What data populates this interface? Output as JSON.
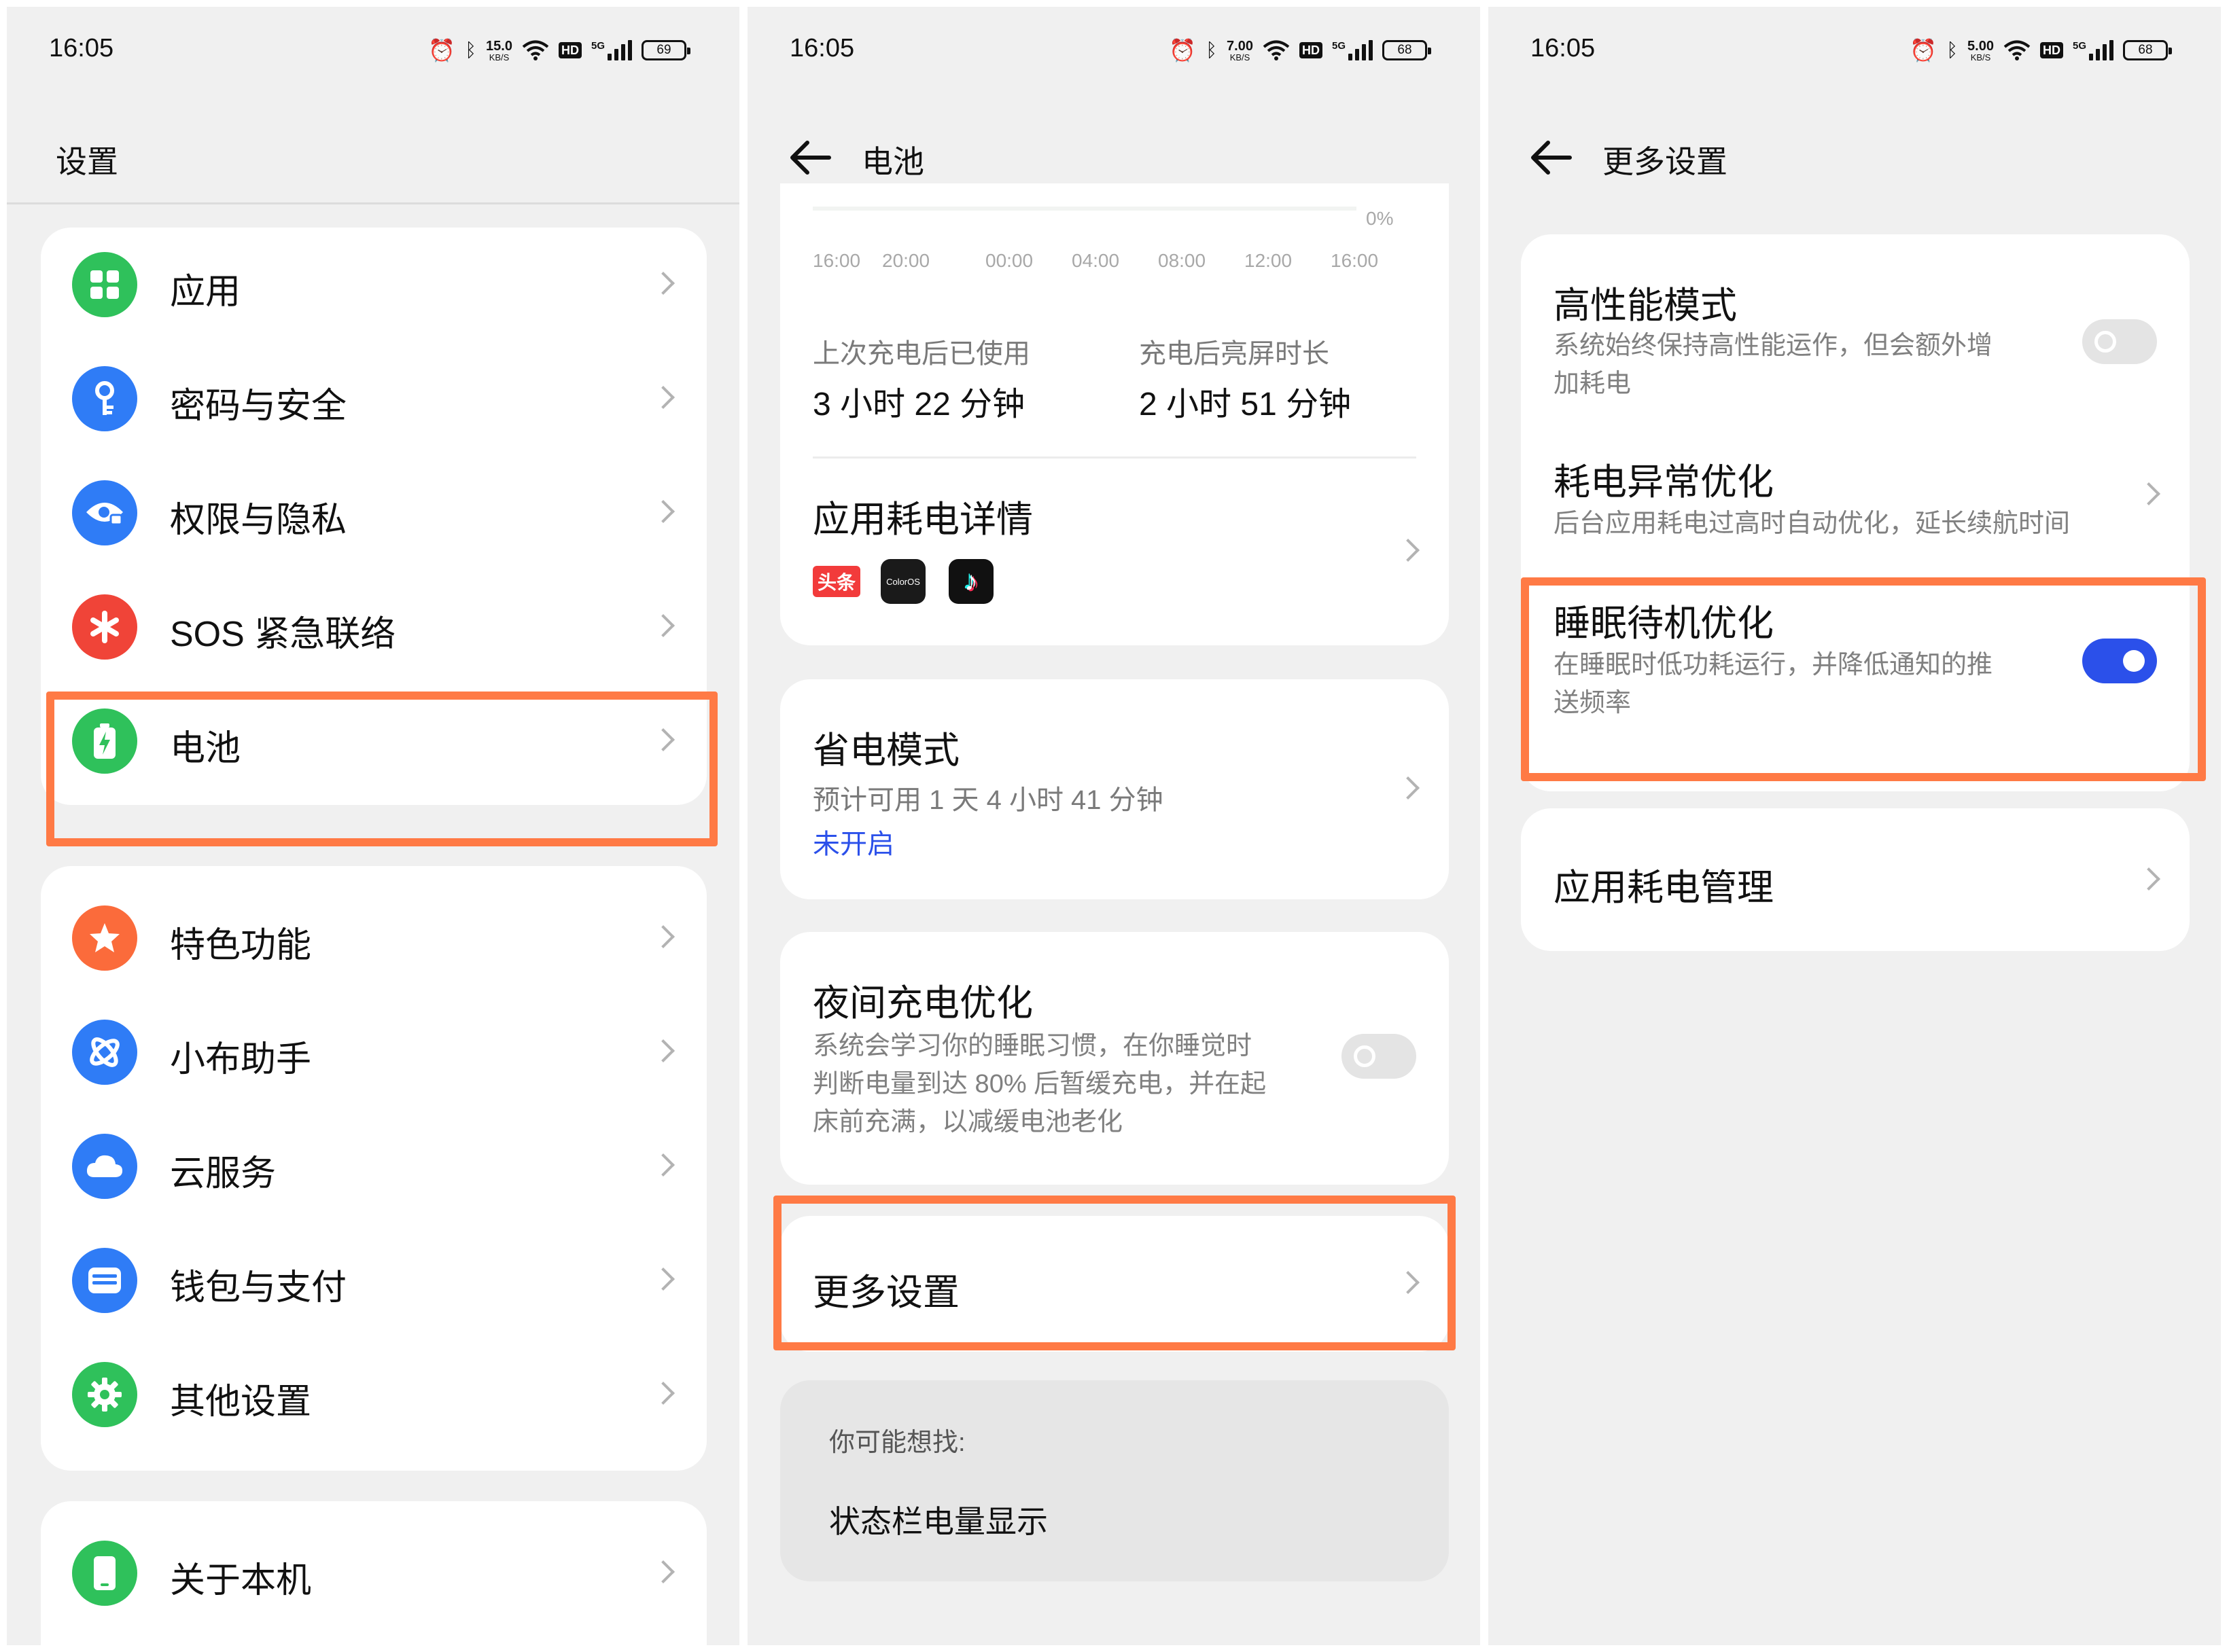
{
  "screens": [
    {
      "status": {
        "time": "16:05",
        "speed_value": "15.0",
        "speed_unit": "KB/S",
        "hd": "HD",
        "network": "5G",
        "battery": "69"
      },
      "title": "设置",
      "group1": [
        {
          "label": "应用",
          "icon": "apps-grid-icon",
          "color": "#2fc15b"
        },
        {
          "label": "密码与安全",
          "icon": "key-icon",
          "color": "#2f7cf6"
        },
        {
          "label": "权限与隐私",
          "icon": "privacy-eye-icon",
          "color": "#2f7cf6"
        },
        {
          "label": "SOS 紧急联络",
          "icon": "sos-asterisk-icon",
          "color": "#f04438"
        },
        {
          "label": "电池",
          "icon": "battery-icon",
          "color": "#2fc15b"
        }
      ],
      "group2": [
        {
          "label": "特色功能",
          "icon": "star-icon",
          "color": "#fb6b3b"
        },
        {
          "label": "小布助手",
          "icon": "assistant-icon",
          "color": "#2f7cf6"
        },
        {
          "label": "云服务",
          "icon": "cloud-icon",
          "color": "#2f7cf6"
        },
        {
          "label": "钱包与支付",
          "icon": "wallet-icon",
          "color": "#2f7cf6"
        },
        {
          "label": "其他设置",
          "icon": "gear-icon",
          "color": "#2fc15b"
        }
      ],
      "group3": [
        {
          "label": "关于本机",
          "icon": "phone-icon",
          "color": "#2fc15b"
        }
      ]
    },
    {
      "status": {
        "time": "16:05",
        "speed_value": "7.00",
        "speed_unit": "KB/S",
        "hd": "HD",
        "network": "5G",
        "battery": "68"
      },
      "title": "电池",
      "chart": {
        "pct": "0%",
        "ticks": [
          "16:00",
          "20:00",
          "00:00",
          "04:00",
          "08:00",
          "12:00",
          "16:00"
        ]
      },
      "usage": {
        "since_charge_label": "上次充电后已使用",
        "since_charge_value": "3 小时 22 分钟",
        "screen_on_label": "充电后亮屏时长",
        "screen_on_value": "2 小时 51 分钟"
      },
      "app_details_title": "应用耗电详情",
      "app_icons": [
        "头条",
        "ColorOS",
        "♪"
      ],
      "power_saving": {
        "title": "省电模式",
        "estimate": "预计可用 1 天 4 小时 41 分钟",
        "state": "未开启"
      },
      "night_charge": {
        "title": "夜间充电优化",
        "desc_lines": [
          "系统会学习你的睡眠习惯，在你睡觉时",
          "判断电量到达 80% 后暂缓充电，并在起",
          "床前充满，以减缓电池老化"
        ],
        "enabled": false
      },
      "more_settings": "更多设置",
      "suggest": {
        "heading": "你可能想找:",
        "item": "状态栏电量显示"
      }
    },
    {
      "status": {
        "time": "16:05",
        "speed_value": "5.00",
        "speed_unit": "KB/S",
        "hd": "HD",
        "network": "5G",
        "battery": "68"
      },
      "title": "更多设置",
      "high_perf": {
        "title": "高性能模式",
        "desc_lines": [
          "系统始终保持高性能运作，但会额外增",
          "加耗电"
        ],
        "enabled": false
      },
      "abnormal": {
        "title": "耗电异常优化",
        "desc": "后台应用耗电过高时自动优化，延长续航时间"
      },
      "sleep_standby": {
        "title": "睡眠待机优化",
        "desc_lines": [
          "在睡眠时低功耗运行，并降低通知的推",
          "送频率"
        ],
        "enabled": true
      },
      "app_power_mgmt": "应用耗电管理"
    }
  ],
  "colors": {
    "highlight": "#ff7a45",
    "toggle_on": "#2b50ea",
    "link": "#2b50ea"
  }
}
